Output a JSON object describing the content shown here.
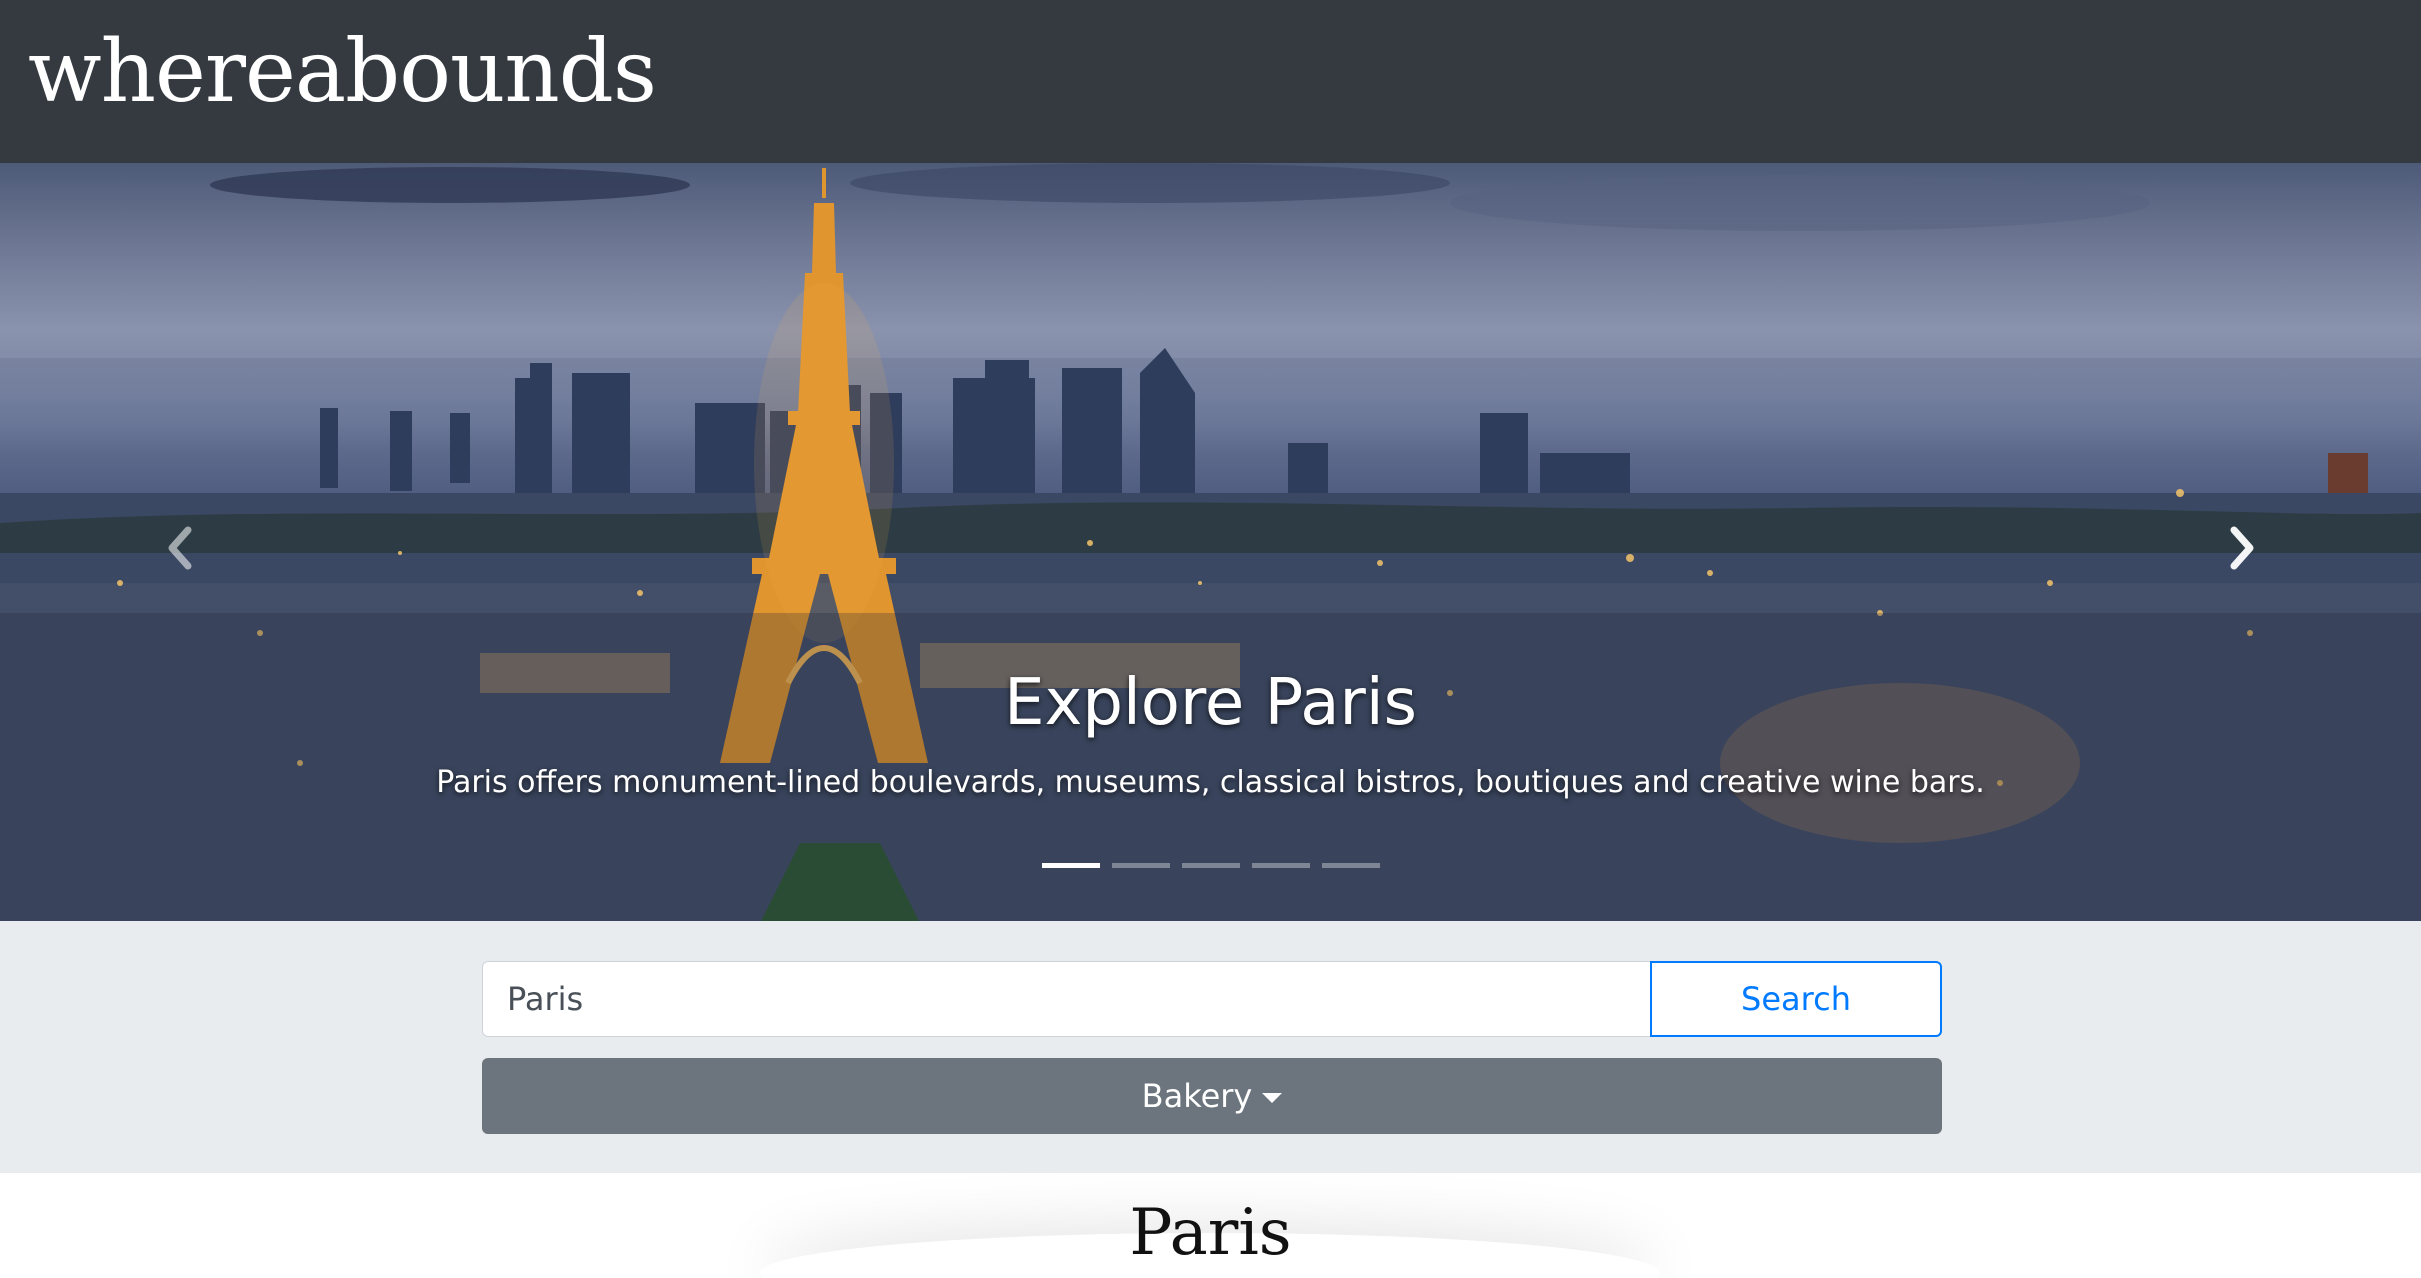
{
  "navbar": {
    "brand": "whereabounds"
  },
  "hero": {
    "title": "Explore Paris",
    "text": "Paris offers monument-lined boulevards, museums, classical bistros, boutiques and creative wine bars.",
    "prev_icon": "chevron-left-icon",
    "next_icon": "chevron-right-icon",
    "slide_count": 5,
    "active_slide": 1
  },
  "search": {
    "value": "Paris",
    "button_label": "Search",
    "category_selected": "Bakery"
  },
  "results": {
    "heading": "Paris"
  },
  "colors": {
    "navbar_bg": "#343a40",
    "search_area_bg": "#e9ecef",
    "primary": "#007bff",
    "secondary": "#6c757d"
  }
}
